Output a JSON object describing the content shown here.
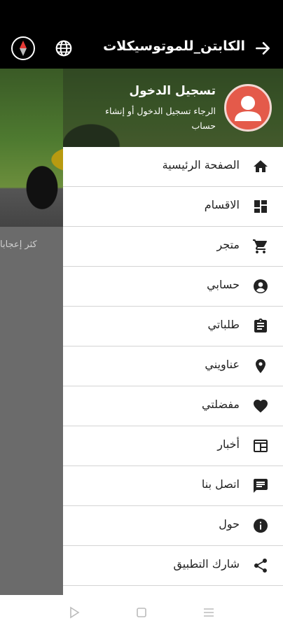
{
  "appbar": {
    "title": "الكابتن_للموتوسيكلات",
    "back_icon": "arrow-right-icon",
    "language_icon": "globe-icon",
    "compass_icon": "compass-icon"
  },
  "background_page": {
    "partial_text": "كثر إعجابا"
  },
  "drawer": {
    "header": {
      "title": "تسجيل الدخول",
      "subtitle": "الرجاء تسجيل الدخول أو إنشاء حساب",
      "avatar_color": "#e45a4a"
    },
    "items": [
      {
        "label": "الصفحة الرئيسية",
        "icon": "home-icon"
      },
      {
        "label": "الاقسام",
        "icon": "dashboard-icon"
      },
      {
        "label": "متجر",
        "icon": "cart-icon"
      },
      {
        "label": "حسابي",
        "icon": "account-icon"
      },
      {
        "label": "طلباتي",
        "icon": "clipboard-icon"
      },
      {
        "label": "عناويني",
        "icon": "location-icon"
      },
      {
        "label": "مفضلتي",
        "icon": "heart-icon"
      },
      {
        "label": "أخبار",
        "icon": "news-icon"
      },
      {
        "label": "اتصل بنا",
        "icon": "chat-icon"
      },
      {
        "label": "حول",
        "icon": "info-icon"
      },
      {
        "label": "شارك التطبيق",
        "icon": "share-icon"
      }
    ]
  },
  "navbar": {
    "back": "triangle-back-icon",
    "home": "square-home-icon",
    "menu": "recent-apps-icon"
  }
}
